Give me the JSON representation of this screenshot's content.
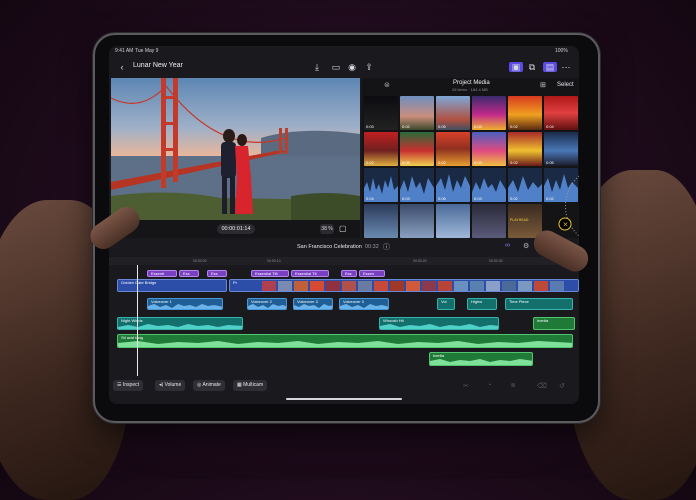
{
  "status_bar": {
    "time": "9:41 AM",
    "date": "Tue May 9",
    "battery": "100%"
  },
  "header": {
    "back_icon": "chevron-left-icon",
    "project_title": "Lunar New Year",
    "center_icons": [
      "import-icon",
      "camera-icon",
      "voiceover-icon",
      "share-icon"
    ],
    "right_icons": [
      "photos-icon",
      "clips-icon",
      "inspector-icon",
      "more-icon"
    ]
  },
  "viewer": {
    "timecode": "00:00:01:14",
    "zoom": "38 %"
  },
  "browser": {
    "title": "Project Media",
    "subtitle": "26 items · 184.4 MB",
    "select_label": "Select",
    "thumb_durations": [
      "0:03",
      "0:02",
      "0:05",
      "0:03",
      "0:02",
      "0:04",
      "0:02",
      "0:05",
      "0:02",
      "0:03",
      "0:02",
      "0:05",
      "0:04",
      "0:03",
      "0:06",
      "0:03",
      "0:02",
      "0:02"
    ],
    "playhead_label": "PLAYHEAD"
  },
  "timeline": {
    "project_name": "San Francisco Celebration",
    "duration": "00:32",
    "ruler_ticks": [
      "00:00:00",
      "00:00:10",
      "00:00:20",
      "00:00:30"
    ],
    "title_clips": [
      "Essenti",
      "Ess",
      "Ess",
      "Essential Titl",
      "Essential Tit",
      "Ess",
      "Essen"
    ],
    "video_clips": [
      "Golden Gate Bridge",
      "Pr"
    ],
    "voiceovers": [
      "Voiceover 1",
      "Voiceover 2",
      "Voiceover 3",
      "Voiceover 3",
      "Vol",
      "Highw",
      "Time Piece"
    ],
    "audio_teal": [
      "Night Winds",
      "Whoosh Hit",
      "Inertia"
    ],
    "audio_green": [
      "Sti acid fang",
      "Inertia"
    ]
  },
  "bottom_bar": {
    "inspect": "Inspect",
    "volume": "Volume",
    "animate": "Animate",
    "multicam": "Multicam"
  }
}
